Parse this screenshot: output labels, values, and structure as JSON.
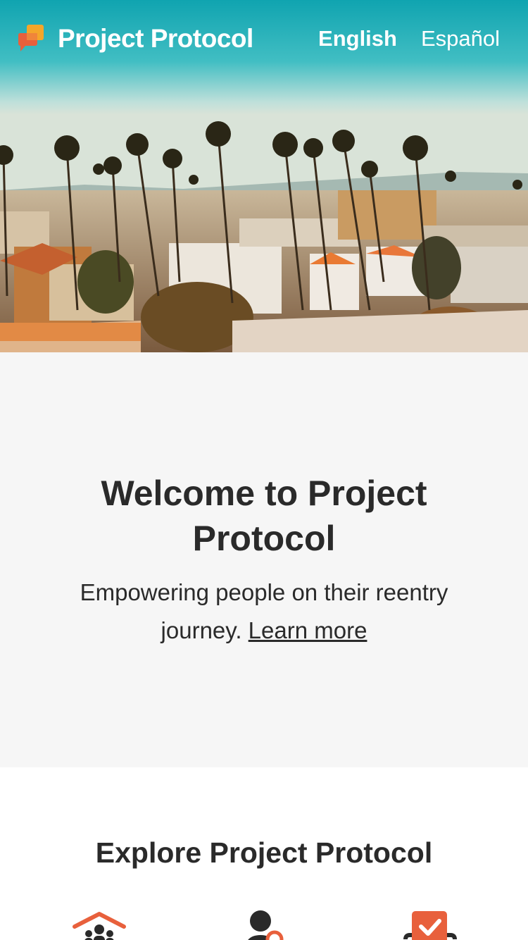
{
  "header": {
    "brand_name": "Project Protocol",
    "logo_icon": "speech-bubbles-logo-icon",
    "languages": [
      {
        "label": "English",
        "active": true
      },
      {
        "label": "Español",
        "active": false
      }
    ]
  },
  "hero": {
    "image": "city-skyline-palm-trees-photo"
  },
  "welcome": {
    "title": "Welcome to Project Protocol",
    "tagline": "Empowering people on their reentry journey.",
    "learn_more": "Learn more"
  },
  "explore": {
    "title": "Explore Project Protocol",
    "icons": [
      "house-people-icon",
      "person-location-icon",
      "checklist-icon"
    ]
  },
  "colors": {
    "accent": "#e8603c",
    "accent_yellow": "#f4a62a",
    "text": "#2a2a2a",
    "welcome_bg": "#f6f6f6"
  }
}
